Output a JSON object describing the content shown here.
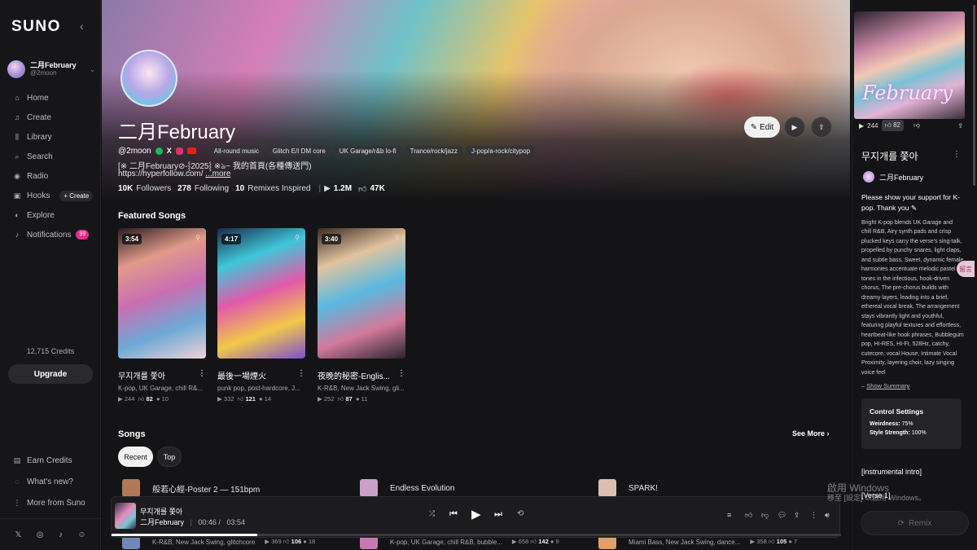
{
  "sidebar": {
    "logo": "SUNO",
    "collapse_icon": "chevron-left-icon",
    "user": {
      "name": "二月February",
      "handle": "@2moon"
    },
    "nav": [
      {
        "label": "Home",
        "icon": "home-icon"
      },
      {
        "label": "Create",
        "icon": "music-note-icon"
      },
      {
        "label": "Library",
        "icon": "library-icon"
      },
      {
        "label": "Search",
        "icon": "search-icon"
      },
      {
        "label": "Radio",
        "icon": "radio-icon"
      },
      {
        "label": "Hooks",
        "icon": "hooks-icon"
      },
      {
        "label": "Explore",
        "icon": "compass-icon"
      },
      {
        "label": "Notifications",
        "icon": "bell-icon"
      }
    ],
    "hooks_create": "+ Create",
    "notifications_badge": "99",
    "credits": "12,715 Credits",
    "upgrade": "Upgrade",
    "bottom": [
      {
        "label": "Earn Credits",
        "icon": "credits-icon"
      },
      {
        "label": "What's new?",
        "icon": "chat-icon"
      },
      {
        "label": "More from Suno",
        "icon": "more-icon"
      }
    ]
  },
  "profile": {
    "name": "二月February",
    "handle": "@2moon",
    "tags": [
      "All-round music",
      "Glitch E/I DM core",
      "UK Garage/r&b lo-fi",
      "Trance/rock/jazz",
      "J-pop/a-rock/citypop"
    ],
    "bio_line1": "[※ 二月February⊘-⸾2025⸾ ※ঌ~ 我的首頁(各種傳送門)",
    "bio_line2": "https://hyperfollow.com/",
    "bio_more": "...more",
    "followers": "10K",
    "followers_label": "Followers",
    "following": "278",
    "following_label": "Following",
    "remixes": "10",
    "remixes_label": "Remixes Inspired",
    "plays": "1.2M",
    "likes": "47K",
    "edit": "Edit"
  },
  "featured": {
    "title": "Featured Songs",
    "cards": [
      {
        "duration": "3:54",
        "title": "무지개를 쫓아",
        "sub": "K-pop, UK Garage, chill R&...",
        "plays": "244",
        "likes": "82",
        "comments": "10",
        "colors": [
          "#2a1c22",
          "#e09a8a",
          "#c86fb2",
          "#6ea9d6",
          "#f0d2d8"
        ]
      },
      {
        "duration": "4:17",
        "title": "最後一場煙火",
        "sub": "punk pop, post-hardcore, J...",
        "plays": "332",
        "likes": "121",
        "comments": "14",
        "colors": [
          "#1a2a4a",
          "#3fc6d9",
          "#e25aa8",
          "#f2c84a",
          "#7e4fd0"
        ]
      },
      {
        "duration": "3:40",
        "title": "夜晚的秘密-Englis...",
        "sub": "K-R&B, New Jack Swing, gli...",
        "plays": "252",
        "likes": "87",
        "comments": "11",
        "colors": [
          "#3a2a22",
          "#e2c3a0",
          "#5ab8e0",
          "#d27a9a",
          "#2a2430"
        ]
      }
    ]
  },
  "songs": {
    "title": "Songs",
    "see_more": "See More",
    "tabs": [
      "Recent",
      "Top"
    ],
    "rows": [
      {
        "title": "般若心經-Poster 2 — 151bpm",
        "color": "#b07a5a"
      },
      {
        "title": "Endless Evolution",
        "color": "#c9a0c8"
      },
      {
        "title": "SPARK!",
        "color": "#d9c0b0"
      }
    ],
    "rows2": [
      {
        "sub": "K-R&B, New Jack Swing, glitchcore",
        "plays": "369",
        "likes": "106",
        "comments": "18",
        "color": "#6f88b5"
      },
      {
        "sub": "K-pop, UK Garage, chill R&B, bubble...",
        "plays": "658",
        "likes": "142",
        "comments": "9",
        "color": "#c87ab0"
      },
      {
        "sub": "Miami Bass, New Jack Swing, dance...",
        "plays": "358",
        "likes": "105",
        "comments": "7",
        "color": "#e0a06a"
      }
    ]
  },
  "player": {
    "title": "무지개를 쫓아",
    "artist": "二月February",
    "current": "00:46 /",
    "total": "03:54",
    "progress": 0.2
  },
  "right": {
    "cover_word": "February",
    "plays": "244",
    "likes": "82",
    "title": "무지개를 쫓아",
    "artist": "二月February",
    "support": "Please show your support for K-pop. Thank you",
    "description": "Bright K-pop blends UK Garage and chill R&B, Airy synth pads and crisp plucked keys carry the verse's sing-talk, propelled by punchy snares, light claps, and subtle bass, Sweet, dynamic female harmonies accentuate melodic pastel tones in the infectious, hook-driven chorus, The pre-chorus builds with dreamy layers, leading into a brief, ethereal vocal break, The arrangement stays vibrantly light and youthful, featuring playful textures and effortless, heartbeat-like hook phrases, Bubblegum pop, HI-RES, HI-FI, 528Hz, catchy, cutecore, vocal House, Intimate Vocal Proximity, layering choir, lazy singing voice feel",
    "show_summary": "Show Summary",
    "control_title": "Control Settings",
    "weirdness_label": "Weirdness:",
    "weirdness": "75%",
    "style_label": "Style Strength:",
    "style": "100%",
    "lyric1": "[instrumental intro]",
    "lyric2": "[Verse 1]",
    "remix": "Remix"
  },
  "overlay": {
    "watermark1": "啟用 Windows",
    "watermark2": "移至 [設定] 以啟用 Windows。",
    "float_btn": "留言"
  }
}
